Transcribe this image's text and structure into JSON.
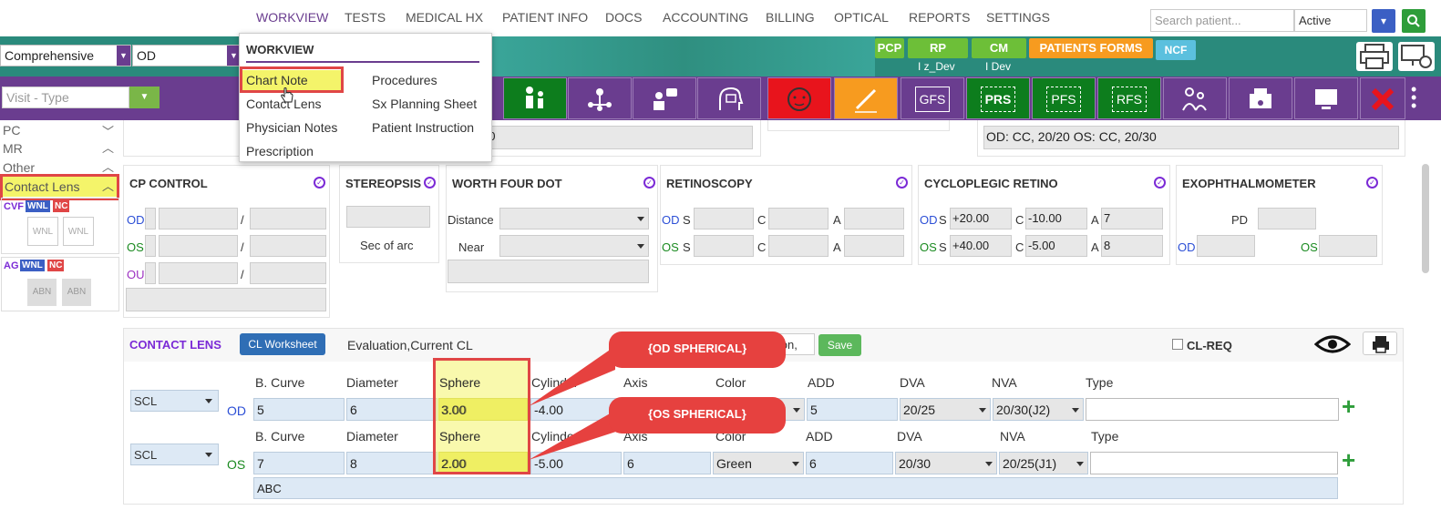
{
  "topnav": {
    "items": [
      "WORKVIEW",
      "TESTS",
      "MEDICAL HX",
      "PATIENT INFO",
      "DOCS",
      "ACCOUNTING",
      "BILLING",
      "OPTICAL",
      "REPORTS",
      "SETTINGS"
    ],
    "search_placeholder": "Search patient...",
    "status_value": "Active"
  },
  "header": {
    "exam_type": "Comprehensive",
    "eye": "OD",
    "visit_type_placeholder": "Visit - Type",
    "tags": {
      "pcp": "PCP",
      "rp": "RP",
      "rp_sub": "I z_Dev",
      "cm": "CM",
      "cm_sub": "I Dev",
      "forms": "PATIENTS FORMS",
      "ncf": "NCF"
    }
  },
  "toolbar": {
    "gfs": "GFS",
    "prs": "PRS",
    "pfs": "PFS",
    "rfs": "RFS"
  },
  "menu": {
    "title": "WORKVIEW",
    "col1": [
      "Chart Note",
      "Contact Lens",
      "Physician Notes",
      "Prescription"
    ],
    "col2": [
      "Procedures",
      "Sx Planning Sheet",
      "Patient Instruction"
    ]
  },
  "sidebar": {
    "items": [
      "PC",
      "MR",
      "Other",
      "Contact Lens"
    ],
    "cvf": "CVF",
    "wnl": "WNL",
    "nc": "NC",
    "ag": "AG",
    "abn": "ABN"
  },
  "top_fields": {
    "note_partial": "30",
    "vision_note": "OD: CC, 20/20 OS: CC, 20/30"
  },
  "cp_control": {
    "title": "CP CONTROL",
    "od": "OD",
    "os": "OS",
    "ou": "OU",
    "sep": "/"
  },
  "stereopsis": {
    "title": "STEREOPSIS",
    "unit": "Sec of arc"
  },
  "worth": {
    "title": "WORTH FOUR DOT",
    "distance": "Distance",
    "near": "Near"
  },
  "retinoscopy": {
    "title": "RETINOSCOPY",
    "od": "OD",
    "os": "OS",
    "s": "S",
    "c": "C",
    "a": "A"
  },
  "cyclo": {
    "title": "CYCLOPLEGIC RETINO",
    "od": "OD",
    "os": "OS",
    "s": "S",
    "c": "C",
    "a": "A",
    "od_s": "+20.00",
    "od_c": "-10.00",
    "od_a": "7",
    "os_s": "+40.00",
    "os_c": "-5.00",
    "os_a": "8"
  },
  "exo": {
    "title": "EXOPHTHALMOMETER",
    "pd": "PD",
    "od": "OD",
    "os": "OS"
  },
  "contact_lens": {
    "title": "CONTACT LENS",
    "worksheet_btn": "CL Worksheet",
    "eval_text": "Evaluation,Current CL",
    "eval_partial": "ation,",
    "save_btn": "Save",
    "clreq": "CL-REQ",
    "headers": [
      "B. Curve",
      "Diameter",
      "Sphere",
      "Cylinder",
      "Axis",
      "Color",
      "ADD",
      "DVA",
      "NVA",
      "Type"
    ],
    "od": {
      "label": "OD",
      "type": "SCL",
      "bcurve": "5",
      "diameter": "6",
      "sphere": "3.00",
      "cylinder": "-4.00",
      "axis": "",
      "color": "",
      "add": "5",
      "dva": "20/25",
      "nva": "20/30(J2)",
      "lens_type": ""
    },
    "os": {
      "label": "OS",
      "type": "SCL",
      "bcurve": "7",
      "diameter": "8",
      "sphere": "2.00",
      "cylinder": "-5.00",
      "axis": "6",
      "color": "Green",
      "add": "6",
      "dva": "20/30",
      "nva": "20/25(J1)",
      "lens_type": ""
    },
    "notes": "ABC"
  },
  "callouts": {
    "od": "{OD SPHERICAL}",
    "os": "{OS SPHERICAL}"
  },
  "colors": {
    "purple": "#6a3d8f",
    "teal": "#2a8a7c",
    "green": "#0d7d1d",
    "red": "#e04646",
    "callout": "#e6413f",
    "highlight": "#f4f46a"
  }
}
